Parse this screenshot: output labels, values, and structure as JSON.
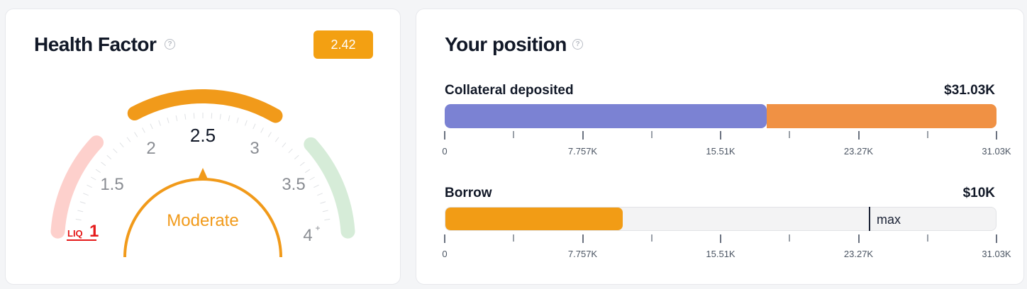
{
  "health_factor": {
    "title": "Health Factor",
    "help_icon": "question-circle-icon",
    "value_badge": "2.42",
    "value": 2.42,
    "status": "Moderate",
    "center_label": "2.5",
    "scale_labels": [
      "1.5",
      "2",
      "3",
      "3.5",
      "4"
    ],
    "max_suffix": "+",
    "liq_label": "LIQ",
    "liq_value": "1",
    "colors": {
      "badge": "#f3a012",
      "moderate": "#f19a1a",
      "danger_arc": "#fdd0cc",
      "safe_arc": "#d6ecd8",
      "liq": "#e51a1a"
    }
  },
  "position": {
    "title": "Your position",
    "help_icon": "question-circle-icon",
    "collateral": {
      "label": "Collateral deposited",
      "amount": "$31.03K",
      "segments": [
        {
          "fraction": 0.583,
          "color": "#7b82d3"
        },
        {
          "fraction": 0.417,
          "color": "#f09144"
        }
      ]
    },
    "borrow": {
      "label": "Borrow",
      "amount": "$10K",
      "fill_fraction": 0.322,
      "max_fraction": 0.77,
      "max_label": "max",
      "colors": {
        "fill": "#f29c15",
        "track": "#f3f3f4"
      }
    },
    "axis_labels": [
      "0",
      "7.757K",
      "15.51K",
      "23.27K",
      "31.03K"
    ]
  }
}
